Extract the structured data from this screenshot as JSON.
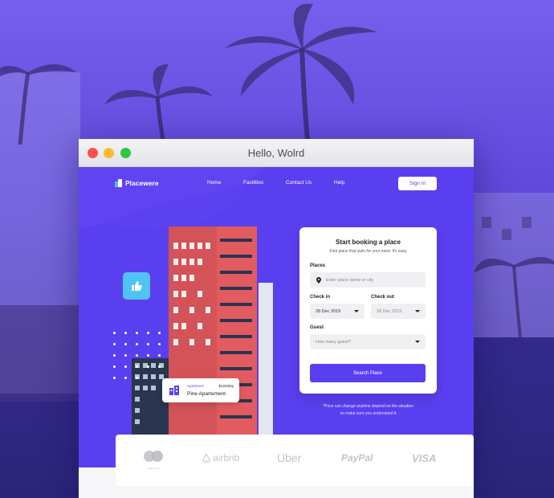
{
  "window": {
    "title": "Hello, Wolrd"
  },
  "nav": {
    "brand": "Placewere",
    "links": [
      "Home",
      "Facilities",
      "Contact Us",
      "Help"
    ],
    "signin_label": "Sign In"
  },
  "apartment_card": {
    "type": "Apartment",
    "price": "$120/day",
    "name": "Pine Apartement"
  },
  "booking_form": {
    "title": "Start booking a place",
    "subtitle": "Find place that suits for your need, it's easy",
    "places_label": "Places",
    "places_placeholder": "Enter place name or city",
    "checkin_label": "Check in",
    "checkin_value": "28 Dec 2019",
    "checkout_label": "Check out",
    "checkout_value": "28 Dec 2019",
    "guest_label": "Guest",
    "guest_placeholder": "How many guest?",
    "search_label": "Search Place"
  },
  "note": {
    "line1": "*Price can change anytime depend on the situation",
    "line2": "so make sure you understand it"
  },
  "partners": [
    "mastercard",
    "airbnb",
    "Uber",
    "PayPal",
    "VISA"
  ],
  "colors": {
    "accent": "#5a3ff0",
    "thumb_tile": "#4fc4f4",
    "building_red": "#e25b5f"
  },
  "icons": {
    "thumb": "thumbs-up-icon",
    "location": "map-pin-icon",
    "apartment": "building-icon"
  }
}
